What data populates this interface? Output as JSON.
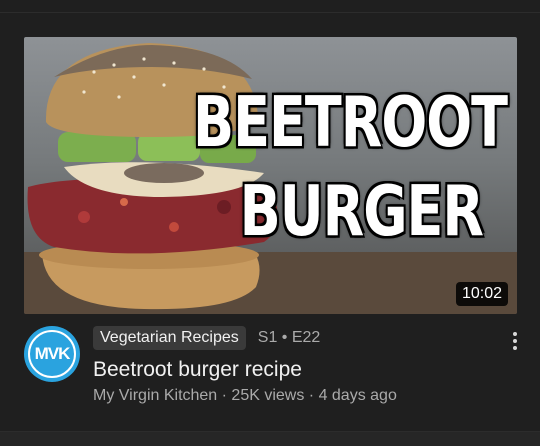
{
  "video": {
    "thumbnail_text_line1": "BEETROOT",
    "thumbnail_text_line2": "BURGER",
    "duration": "10:02",
    "playlist": "Vegetarian Recipes",
    "episode": "S1 • E22",
    "title": "Beetroot burger recipe",
    "channel": "My Virgin Kitchen",
    "views": "25K views",
    "age": "4 days ago",
    "separator": " · "
  },
  "channel_avatar": {
    "initials": "MVK",
    "color": "#2aa3df"
  },
  "icons": {
    "more": "more-vert-icon"
  }
}
